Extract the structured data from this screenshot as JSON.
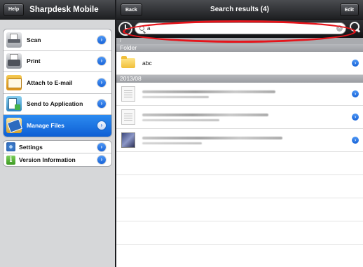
{
  "left": {
    "help_label": "Help",
    "title": "Sharpdesk Mobile",
    "menu": [
      {
        "label": "Scan",
        "icon": "scanner-icon",
        "selected": false
      },
      {
        "label": "Print",
        "icon": "printer-icon",
        "selected": false
      },
      {
        "label": "Attach to E-mail",
        "icon": "email-icon",
        "selected": false
      },
      {
        "label": "Send to Application",
        "icon": "send-app-icon",
        "selected": false
      },
      {
        "label": "Manage Files",
        "icon": "manage-files-icon",
        "selected": true
      }
    ],
    "menu2": [
      {
        "label": "Settings",
        "icon": "gear-icon"
      },
      {
        "label": "Version Information",
        "icon": "info-icon"
      }
    ]
  },
  "right": {
    "back_label": "Back",
    "title": "Search results (4)",
    "edit_label": "Edit",
    "search": {
      "value": "a"
    },
    "path": "/",
    "sections": [
      {
        "header": "Folder",
        "rows": [
          {
            "label": "abc",
            "type": "folder"
          }
        ]
      },
      {
        "header": "2013/08",
        "rows": [
          {
            "type": "document"
          },
          {
            "type": "document"
          },
          {
            "type": "image"
          }
        ]
      }
    ]
  },
  "colors": {
    "highlight": "#e5141b",
    "accent": "#1763d8",
    "selected": "#1a73e8"
  }
}
